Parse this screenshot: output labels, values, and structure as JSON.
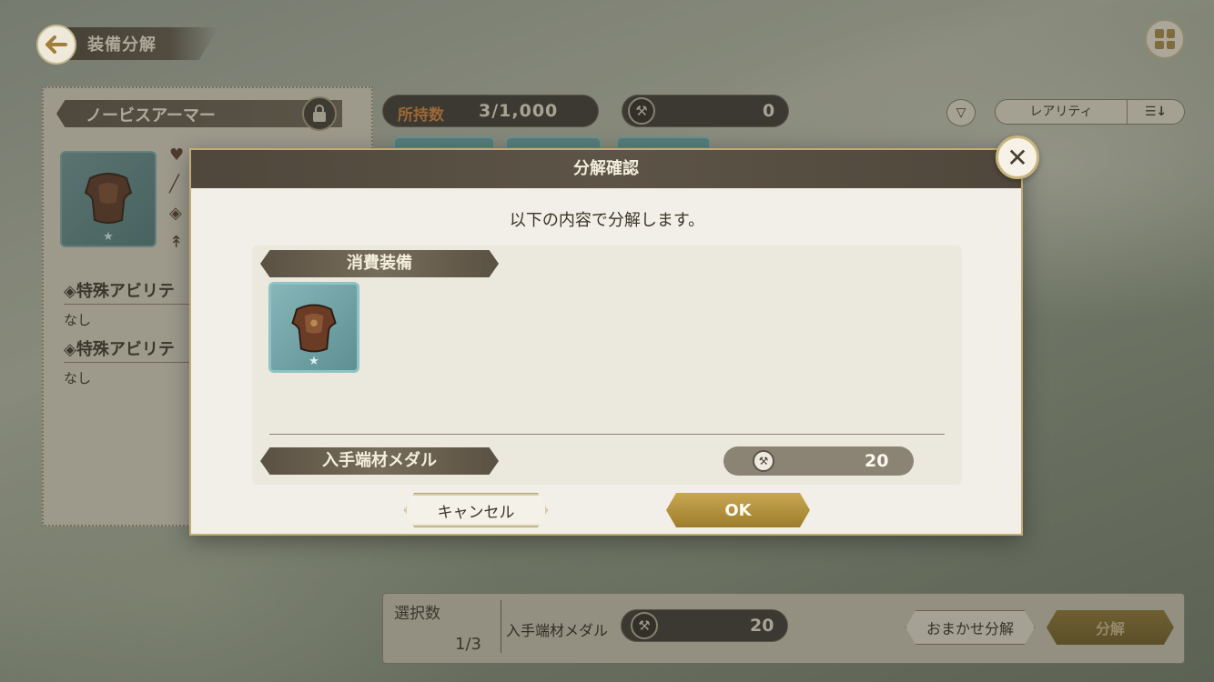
{
  "screen": {
    "title": "装備分解"
  },
  "item_panel": {
    "name": "ノービスアーマー",
    "ability_1_title": "◈特殊アビリテ",
    "ability_1_value": "なし",
    "ability_2_title": "◈特殊アビリテ",
    "ability_2_value": "なし"
  },
  "header": {
    "owned_label": "所持数",
    "owned_value": "3/1,000",
    "medal_value": "0",
    "rarity_label": "レアリティ"
  },
  "bottom_bar": {
    "selected_label": "選択数",
    "selected_value": "1/3",
    "medal_label": "入手端材メダル",
    "medal_value": "20",
    "auto_label": "おまかせ分解",
    "decompose_label": "分解"
  },
  "dialog": {
    "title": "分解確認",
    "message": "以下の内容で分解します。",
    "consumed_header": "消費装備",
    "reward_header": "入手端材メダル",
    "reward_value": "20",
    "cancel_label": "キャンセル",
    "ok_label": "OK"
  },
  "icons": {
    "back": "arrow-left-icon",
    "menu": "grid-menu-icon",
    "lock": "lock-icon",
    "medal": "wrench-medal-icon",
    "filter": "filter-icon",
    "sort": "sort-icon",
    "close": "close-icon",
    "armor": "armor-icon",
    "star": "star-icon"
  },
  "colors": {
    "accent_gold": "#c9a752",
    "dark_banner": "#4f473b",
    "owned_label": "#d8823a"
  }
}
